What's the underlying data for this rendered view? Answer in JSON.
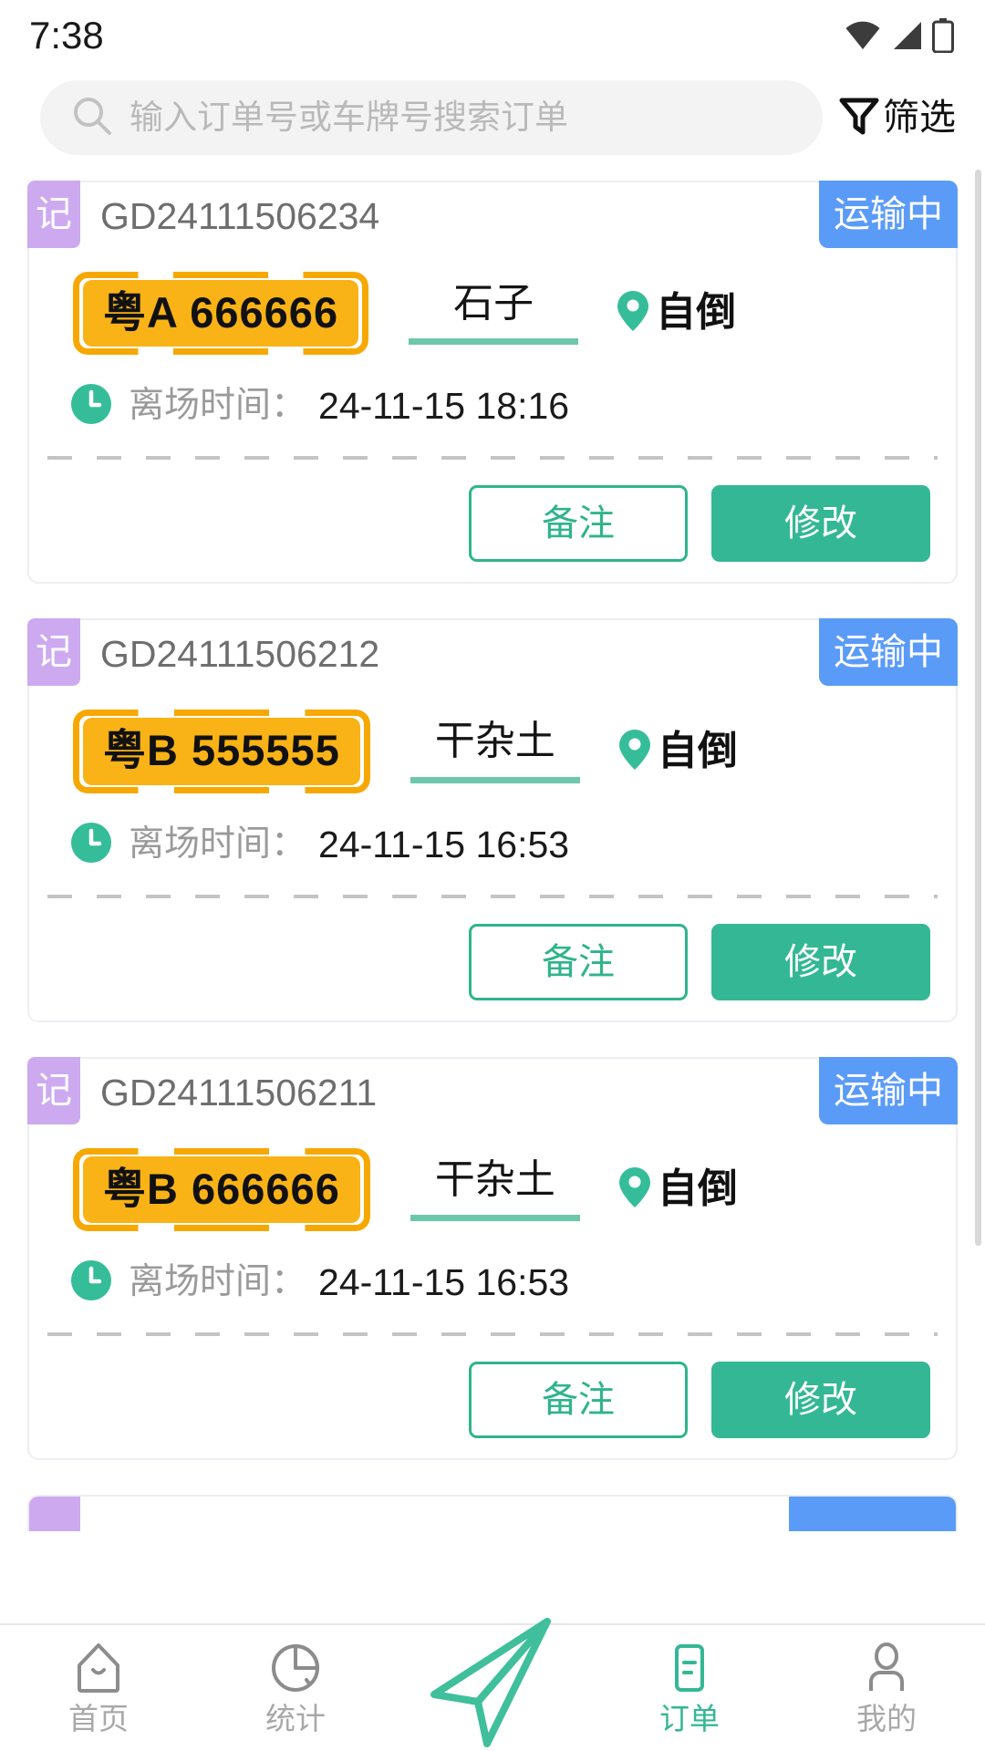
{
  "status_bar": {
    "time": "7:38",
    "icons": [
      "wifi-icon",
      "signal-icon",
      "battery-icon"
    ]
  },
  "header": {
    "search": {
      "placeholder": "输入订单号或车牌号搜索订单",
      "value": "",
      "icon": "search-icon"
    },
    "filter": {
      "label": "筛选",
      "icon": "filter-icon"
    }
  },
  "colors": {
    "accent_green": "#34b795",
    "status_blue": "#5b9bf8",
    "tag_purple": "#cdaaf0",
    "plate_yellow": "#f9b316",
    "plate_border": "#f7a800",
    "muted_text": "#9a9a9a"
  },
  "labels": {
    "record_tag": "记",
    "departure_time": "离场时间：",
    "remark_button": "备注",
    "modify_button": "修改",
    "pin_icon": "location-pin-icon",
    "clock_icon": "clock-icon"
  },
  "orders": [
    {
      "tag": "记",
      "order_no": "GD24111506234",
      "status": "运输中",
      "plate": "粤A 666666",
      "cargo": "石子",
      "unload_mode": "自倒",
      "time_label": "离场时间：",
      "time_value": "24-11-15 18:16",
      "actions": {
        "remark": "备注",
        "modify": "修改"
      }
    },
    {
      "tag": "记",
      "order_no": "GD24111506212",
      "status": "运输中",
      "plate": "粤B 555555",
      "cargo": "干杂土",
      "unload_mode": "自倒",
      "time_label": "离场时间：",
      "time_value": "24-11-15 16:53",
      "actions": {
        "remark": "备注",
        "modify": "修改"
      }
    },
    {
      "tag": "记",
      "order_no": "GD24111506211",
      "status": "运输中",
      "plate": "粤B 666666",
      "cargo": "干杂土",
      "unload_mode": "自倒",
      "time_label": "离场时间：",
      "time_value": "24-11-15 16:53",
      "actions": {
        "remark": "备注",
        "modify": "修改"
      }
    }
  ],
  "tab_bar": {
    "items": [
      {
        "label": "首页",
        "icon": "home-icon",
        "active": false
      },
      {
        "label": "统计",
        "icon": "pie-chart-icon",
        "active": false
      },
      {
        "label": "",
        "icon": "paper-plane-icon",
        "active": false
      },
      {
        "label": "订单",
        "icon": "document-icon",
        "active": true
      },
      {
        "label": "我的",
        "icon": "person-icon",
        "active": false
      }
    ]
  }
}
